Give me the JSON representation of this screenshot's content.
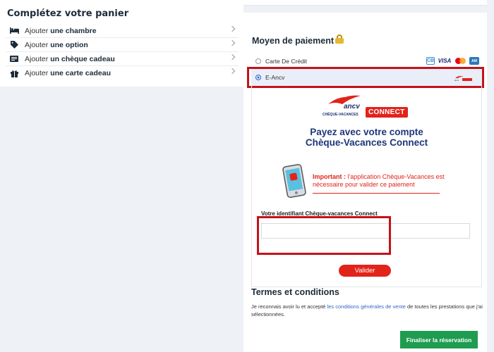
{
  "cart": {
    "title": "Complétez votre panier",
    "items": [
      {
        "prefix": "Ajouter ",
        "bold": "une chambre",
        "icon": "bed-icon"
      },
      {
        "prefix": "Ajouter ",
        "bold": "une option",
        "icon": "tag-icon"
      },
      {
        "prefix": "Ajouter ",
        "bold": "un chèque cadeau",
        "icon": "voucher-icon"
      },
      {
        "prefix": "Ajouter ",
        "bold": "une carte cadeau",
        "icon": "gift-icon"
      }
    ]
  },
  "payment": {
    "title": "Moyen de paiement",
    "options": [
      {
        "label": "Carte De Crédit",
        "selected": false
      },
      {
        "label": "E-Ancv",
        "selected": true
      }
    ],
    "card_brands": [
      "CB",
      "VISA",
      "Mastercard",
      "Amex"
    ]
  },
  "ancv": {
    "logo_text": "ancv",
    "logo_sub": "CHÈQUE-VACANCES",
    "connect_badge": "CONNECT",
    "headline_line1": "Payez avec votre compte",
    "headline_line2": "Chèque-Vacances Connect",
    "important_label": "Important :",
    "important_text": " l'application Chèque-Vacances est nécessaire pour valider ce paiement",
    "id_label": "Votre identifiant Chèque-vacances Connect",
    "id_value": "",
    "validate_label": "Valider"
  },
  "terms": {
    "title": "Termes et conditions",
    "text_before": "Je reconnais avoir lu et accepté ",
    "link_text": "les conditions générales de vente",
    "text_after": " de toutes les prestations que j'ai sélectionnées."
  },
  "finalize_label": "Finaliser la réservation",
  "colors": {
    "accent_red": "#e2231a",
    "frame_red": "#c4121a",
    "green": "#1e9c4f",
    "navy": "#1d3679"
  }
}
